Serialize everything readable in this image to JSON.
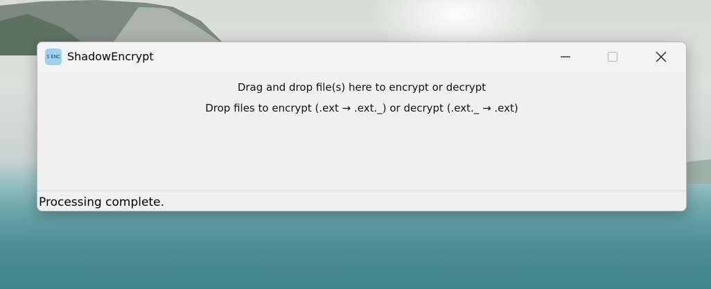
{
  "window": {
    "title": "ShadowEncrypt",
    "icon": {
      "name": "shadowencrypt-app-icon",
      "text": "S ENC",
      "color": "#9fd0f0"
    },
    "controls": {
      "minimize": "minimize-icon",
      "maximize": "maximize-icon",
      "close": "close-icon"
    }
  },
  "main": {
    "line1": "Drag and drop file(s) here to encrypt or decrypt",
    "line2": "Drop files to encrypt (.ext → .ext._) or decrypt (.ext._ → .ext)"
  },
  "status": {
    "text": "Processing complete."
  }
}
